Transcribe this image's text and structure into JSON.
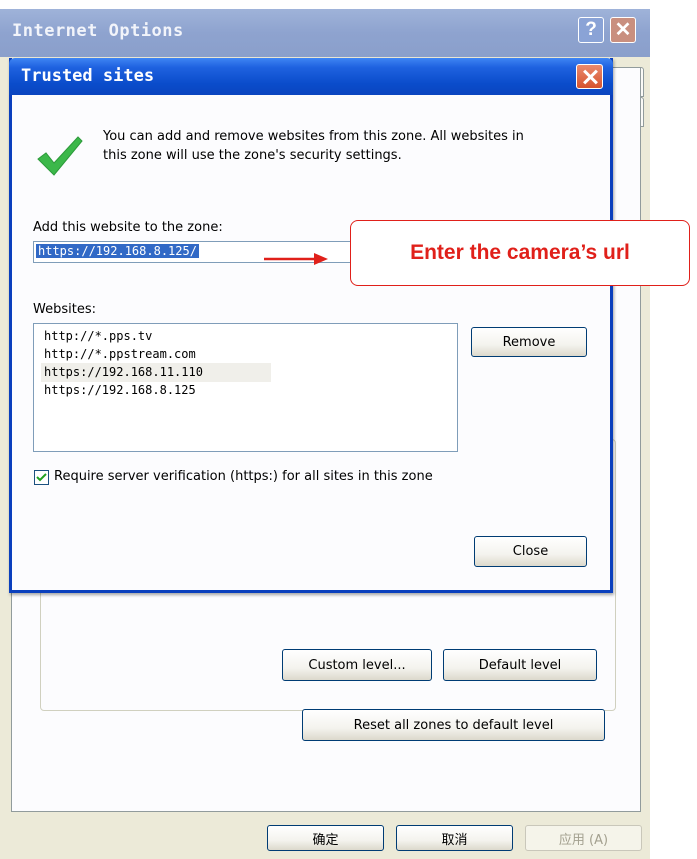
{
  "outer_window": {
    "title": "Internet Options",
    "help_label": "?",
    "buttons": {
      "custom_level": "Custom level...",
      "default_level": "Default level",
      "reset_all": "Reset all zones to default level",
      "ok": "确定",
      "cancel": "取消",
      "apply": "应用 (A)"
    }
  },
  "dialog": {
    "title": "Trusted sites",
    "info_text_line1": "You can add and remove websites from this zone. All websites in",
    "info_text_line2": "this zone will use the zone's security settings.",
    "add_label": "Add this website to the zone:",
    "add_value": "https://192.168.8.125/",
    "websites_label": "Websites:",
    "websites": [
      "http://*.pps.tv",
      "http://*.ppstream.com",
      "https://192.168.11.110",
      "https://192.168.8.125"
    ],
    "remove_label": "Remove",
    "require_https_label": "Require server verification (https:) for all sites in this zone",
    "require_https_checked": true,
    "close_label": "Close"
  },
  "annotation": {
    "text": "Enter the camera’s url"
  },
  "colors": {
    "accent": "#0a4ccb",
    "annotation": "#e0201a",
    "check": "#3cb84a"
  }
}
